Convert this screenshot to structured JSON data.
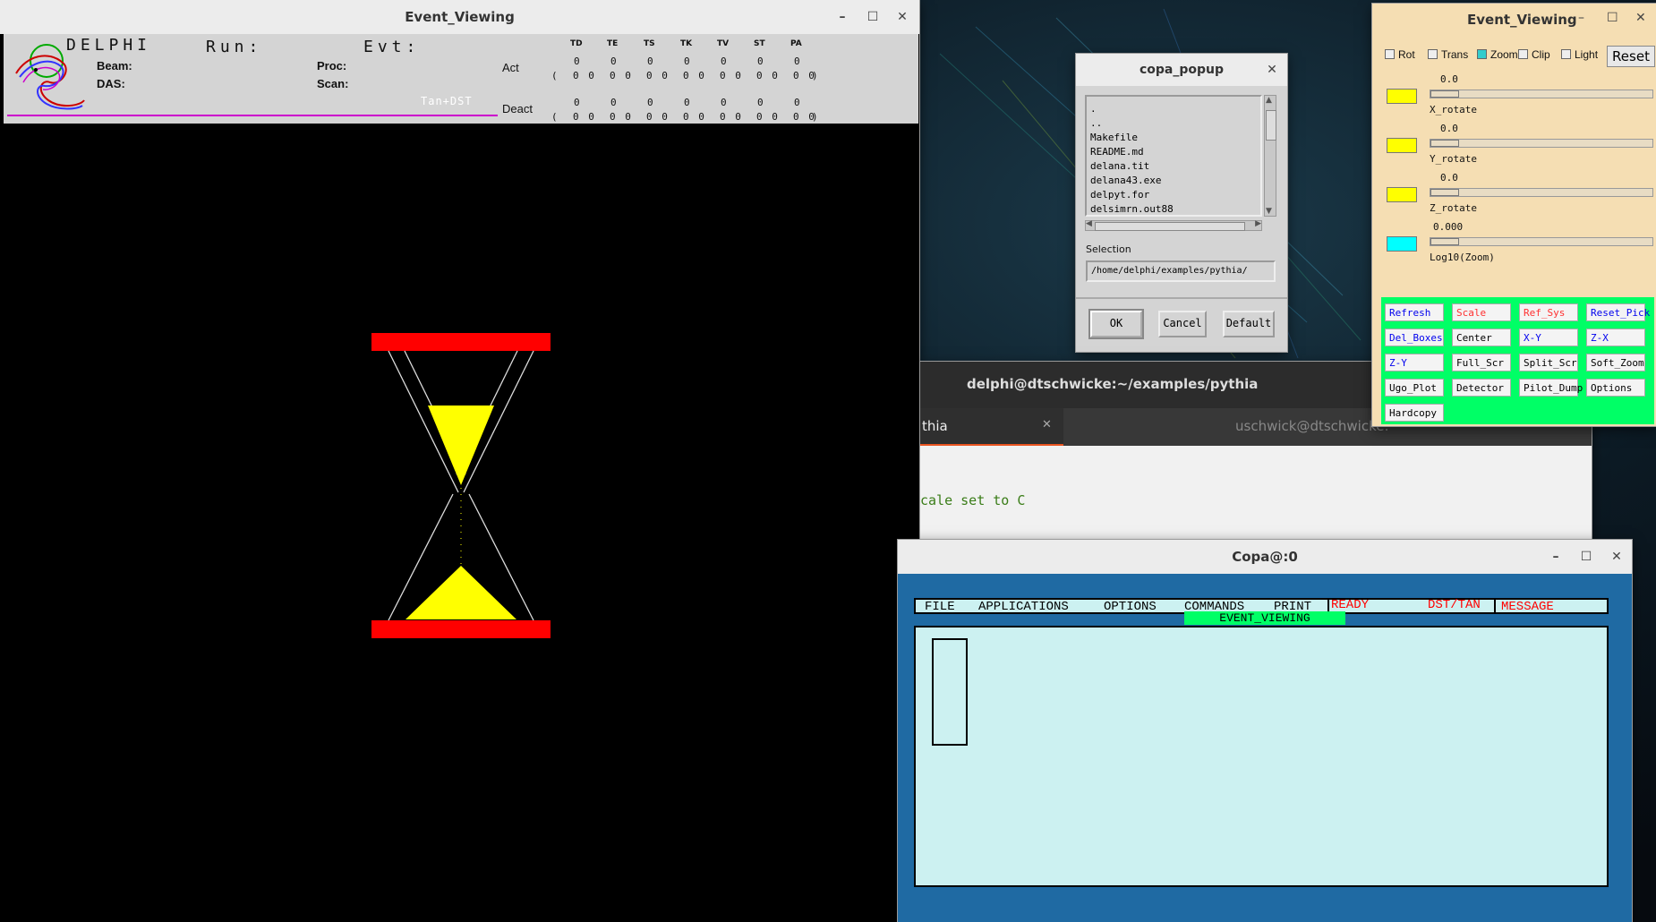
{
  "colors": {
    "red": "#ff0000",
    "yellow": "#ffff00",
    "green": "#00ff66",
    "cyan": "#00ffff",
    "magenta": "#cc00cc",
    "copa_blue": "#1f6aa3",
    "copa_panel": "#ccf1f1"
  },
  "event_viewing": {
    "title": "Event_Viewing",
    "logo_word": "DELPHI",
    "run_label": "Run:",
    "evt_label": "Evt:",
    "beam_label": "Beam:",
    "proc_label": "Proc:",
    "das_label": "DAS:",
    "scan_label": "Scan:",
    "tan_dst": "Tan+DST",
    "act_label": "Act",
    "deact_label": "Deact",
    "columns": [
      "TD",
      "TE",
      "TS",
      "TK",
      "TV",
      "ST",
      "PA"
    ],
    "zero": "0",
    "open_paren": "(",
    "close_paren": ")",
    "pair": "0 0"
  },
  "popup": {
    "title": "copa_popup",
    "files": [
      ".",
      "..",
      "Makefile",
      "README.md",
      "delana.tit",
      "delana43.exe",
      "delpyt.for",
      "delsimrn.out88"
    ],
    "selection_label": "Selection",
    "selection_value": "/home/delphi/examples/pythia/",
    "ok_label": "OK",
    "cancel_label": "Cancel",
    "default_label": "Default"
  },
  "control": {
    "title": "Event_Viewing",
    "checks": [
      {
        "label": "Rot",
        "checked": false
      },
      {
        "label": "Trans",
        "checked": false
      },
      {
        "label": "Zoom",
        "checked": true
      },
      {
        "label": "Clip",
        "checked": false
      },
      {
        "label": "Light",
        "checked": false
      }
    ],
    "reset_label": "Reset",
    "sliders": [
      {
        "value": "0.0",
        "label": "X_rotate",
        "color": "#ffff00"
      },
      {
        "value": "0.0",
        "label": "Y_rotate",
        "color": "#ffff00"
      },
      {
        "value": "0.0",
        "label": "Z_rotate",
        "color": "#ffff00"
      },
      {
        "value": "0.000",
        "label": "Log10(Zoom)",
        "color": "#00ffff"
      }
    ],
    "buttons": [
      {
        "label": "Refresh",
        "color": "#0000ee"
      },
      {
        "label": "Scale",
        "color": "#ff3030"
      },
      {
        "label": "Ref_Sys",
        "color": "#ff3030"
      },
      {
        "label": "Reset_Pick",
        "color": "#0000ee"
      },
      {
        "label": "Del_Boxes",
        "color": "#0000ee"
      },
      {
        "label": "Center",
        "color": "#000000"
      },
      {
        "label": "X-Y",
        "color": "#0000ee"
      },
      {
        "label": "Z-X",
        "color": "#0000ee"
      },
      {
        "label": "Z-Y",
        "color": "#0000ee"
      },
      {
        "label": "Full_Scr",
        "color": "#000000"
      },
      {
        "label": "Split_Scr",
        "color": "#000000"
      },
      {
        "label": "Soft_Zoom",
        "color": "#000000"
      },
      {
        "label": "Ugo_Plot",
        "color": "#000000"
      },
      {
        "label": "Detector",
        "color": "#000000"
      },
      {
        "label": "Pilot_Dump",
        "color": "#000000"
      },
      {
        "label": "Options",
        "color": "#000000"
      },
      {
        "label": "Hardcopy",
        "color": "#000000"
      }
    ]
  },
  "terminal": {
    "title": "delphi@dtschwicke:~/examples/pythia",
    "tab1": "thia",
    "tab2": "uschwick@dtschwicke:",
    "line": "cale set to C"
  },
  "copa": {
    "title": "Copa@:0",
    "menu": [
      "FILE",
      "APPLICATIONS",
      "OPTIONS",
      "COMMANDS",
      "PRINT"
    ],
    "status_ready": "READY",
    "status_dst": "DST/TAN",
    "status_message": "MESSAGE",
    "event_viewing_tag": "EVENT_VIEWING"
  }
}
